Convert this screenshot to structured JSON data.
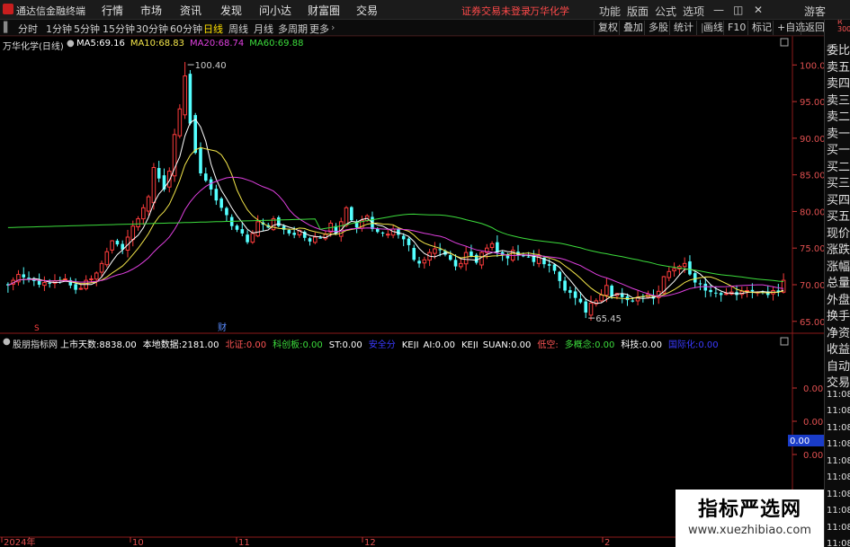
{
  "menubar": {
    "app_title": "通达信金融终端",
    "menus": [
      "行情",
      "市场",
      "资讯",
      "发现",
      "问小达",
      "财富圈",
      "交易"
    ],
    "notice": "证券交易未登录",
    "stock_name": "万华化学",
    "right_items": [
      "功能",
      "版面",
      "公式",
      "选项"
    ],
    "guest": "游客"
  },
  "toolbar": {
    "periods": [
      "分时",
      "1分钟",
      "5分钟",
      "15分钟",
      "30分钟",
      "60分钟",
      "日线",
      "周线",
      "月线",
      "多周期",
      "更多"
    ],
    "active_period": "日线",
    "right_buttons": [
      "复权",
      "叠加",
      "多股",
      "统计",
      "画线",
      "F10",
      "标记",
      "+自选",
      "返回"
    ]
  },
  "chart_header": {
    "title": "万华化学(日线)",
    "ma": [
      {
        "label": "MA5:",
        "value": "69.16",
        "color": "#ffffff"
      },
      {
        "label": "MA10:",
        "value": "68.83",
        "color": "#f4e64a"
      },
      {
        "label": "MA20:",
        "value": "68.74",
        "color": "#e040e0"
      },
      {
        "label": "MA60:",
        "value": "69.88",
        "color": "#3cdc3c"
      }
    ]
  },
  "price_axis": {
    "labels": [
      "100.0",
      "95.00",
      "90.00",
      "85.00",
      "80.00",
      "75.00",
      "70.00",
      "65.00"
    ],
    "top_labels": [
      "R",
      "300"
    ]
  },
  "annotations": {
    "high": "100.40",
    "low": "65.45",
    "marker_s": "S",
    "marker_cai": "财"
  },
  "indicator_header": {
    "name": "股朋指标网",
    "items": [
      {
        "label": "上市天数:",
        "value": "8838.00",
        "color": "#ffffff"
      },
      {
        "label": "本地数据:",
        "value": "2181.00",
        "color": "#ffffff"
      },
      {
        "label": "北证:",
        "value": "0.00",
        "color": "#ff5555"
      },
      {
        "label": "科创板:",
        "value": "0.00",
        "color": "#3cdc3c"
      },
      {
        "label": "ST:",
        "value": "0.00",
        "color": "#ffffff"
      },
      {
        "label": "安全分",
        "value": "",
        "color": "#3a3aff"
      },
      {
        "label": "KEJI_AI:",
        "value": "0.00",
        "color": "#ffffff"
      },
      {
        "label": "KEJI_SUAN:",
        "value": "0.00",
        "color": "#ffffff"
      },
      {
        "label": "低空:",
        "value": "",
        "color": "#ff5555"
      },
      {
        "label": "多概念:",
        "value": "0.00",
        "color": "#3cdc3c"
      },
      {
        "label": "科技:",
        "value": "0.00",
        "color": "#ffffff"
      },
      {
        "label": "国际化:",
        "value": "0.00",
        "color": "#3a3aff"
      }
    ]
  },
  "indicator_axis": {
    "labels": [
      "0.00",
      "0.00",
      "0.00"
    ],
    "current": "0.00"
  },
  "date_axis": {
    "labels": [
      "2024年",
      "10",
      "11",
      "12",
      "2"
    ]
  },
  "quote_panel": {
    "items": [
      "委比",
      "卖五",
      "卖四",
      "卖三",
      "卖二",
      "卖一",
      "买一",
      "买二",
      "买三",
      "买四",
      "买五",
      "现价",
      "涨跌",
      "涨幅",
      "总量",
      "外盘",
      "换手",
      "净资",
      "收益",
      "自动",
      "交易",
      "11:08",
      "11:08",
      "11:08",
      "11:08",
      "11:08",
      "11:08",
      "11:08",
      "11:08",
      "11:08",
      "11:08"
    ]
  },
  "watermark": {
    "title": "指标严选网",
    "url": "www.xuezhibiao.com"
  },
  "chart_data": {
    "type": "candlestick",
    "title": "万华化学(日线)",
    "ylim": [
      63.5,
      102.0
    ],
    "series": [
      {
        "name": "MA5",
        "color": "#ffffff"
      },
      {
        "name": "MA10",
        "color": "#f4e64a"
      },
      {
        "name": "MA20",
        "color": "#e040e0"
      },
      {
        "name": "MA60",
        "color": "#3cdc3c"
      }
    ],
    "closes": [
      69.9,
      70.6,
      71.4,
      71.0,
      70.8,
      70.5,
      70.0,
      70.3,
      70.2,
      70.5,
      70.6,
      70.8,
      69.9,
      69.3,
      69.5,
      70.6,
      70.8,
      71.6,
      72.9,
      74.5,
      76.0,
      75.5,
      74.8,
      76.5,
      78.0,
      79.0,
      80.5,
      82.0,
      86.0,
      84.5,
      83.0,
      85.5,
      90.5,
      94.0,
      98.5,
      92.0,
      88.0,
      85.2,
      84.2,
      83.0,
      81.5,
      80.5,
      79.5,
      78.0,
      77.5,
      77.0,
      75.8,
      77.0,
      78.6,
      78.2,
      77.8,
      79.0,
      78.0,
      77.5,
      77.0,
      76.8,
      77.4,
      76.4,
      75.9,
      76.5,
      76.4,
      76.9,
      78.4,
      77.0,
      78.6,
      80.5,
      78.8,
      77.8,
      78.8,
      79.4,
      77.6,
      77.2,
      77.0,
      76.9,
      77.6,
      76.8,
      76.2,
      75.4,
      73.4,
      72.9,
      73.4,
      74.4,
      74.9,
      74.8,
      74.1,
      73.4,
      72.5,
      72.9,
      74.4,
      73.9,
      73.0,
      74.4,
      75.0,
      75.6,
      74.4,
      74.0,
      73.6,
      74.7,
      74.0,
      73.9,
      73.8,
      73.1,
      73.9,
      72.8,
      72.6,
      71.9,
      70.5,
      69.2,
      68.9,
      68.2,
      67.6,
      66.2,
      67.5,
      67.8,
      68.6,
      69.9,
      68.4,
      68.8,
      68.3,
      67.9,
      67.7,
      68.3,
      68.4,
      68.7,
      68.1,
      69.1,
      71.1,
      71.8,
      72.2,
      72.5,
      72.9,
      71.4,
      70.3,
      70.1,
      69.2,
      69.0,
      68.8,
      68.6,
      68.8,
      69.0,
      68.6,
      69.1,
      69.2,
      69.1,
      69.0,
      69.0,
      68.6,
      69.2,
      69.0,
      70.6
    ],
    "high_label": 100.4,
    "low_label": 65.45
  },
  "indicator_header_note": ""
}
